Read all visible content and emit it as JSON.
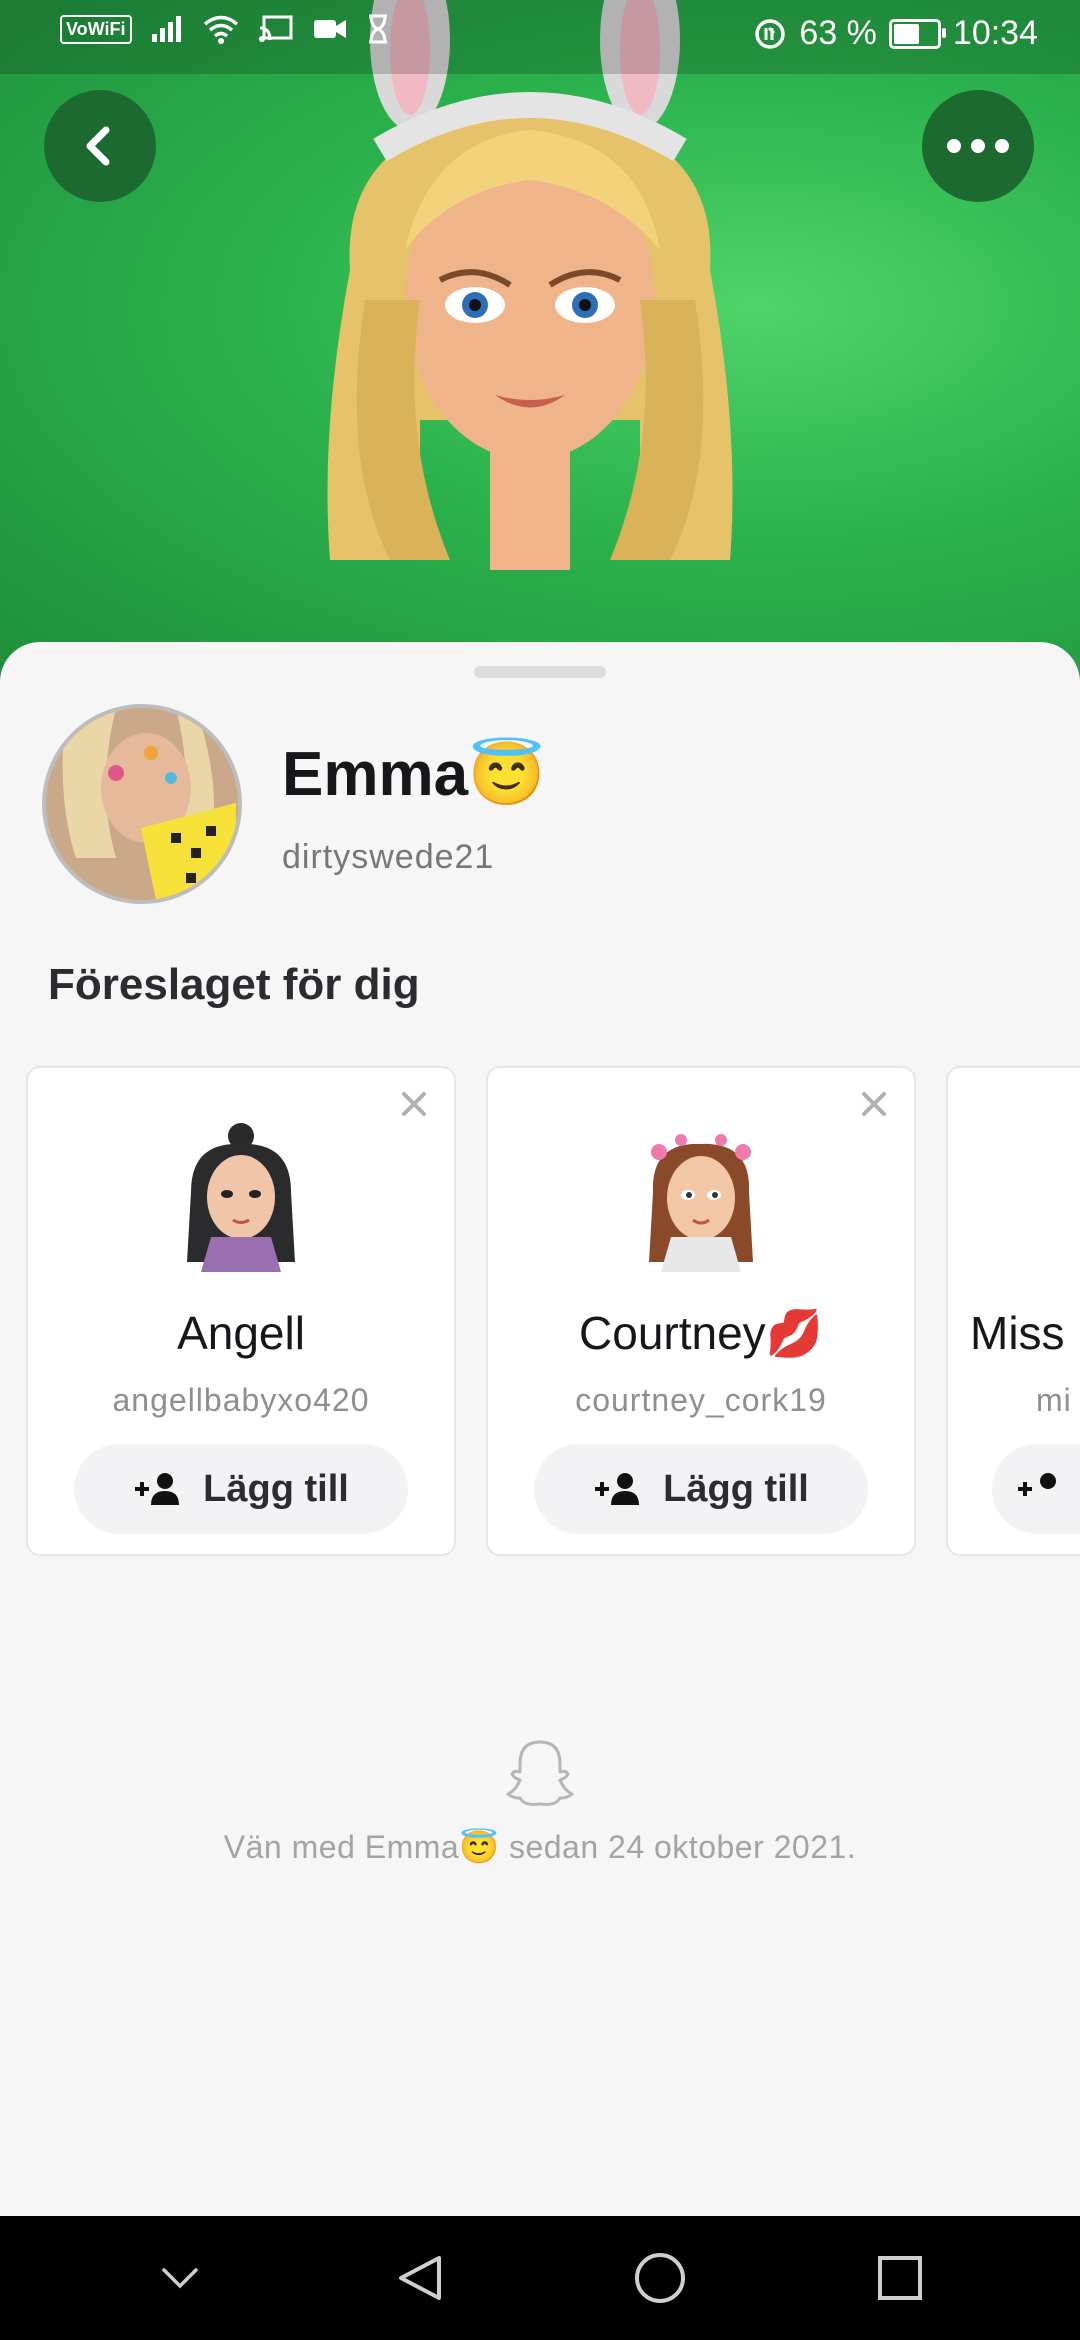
{
  "status_bar": {
    "vowifi": "VoWiFi",
    "battery_percent": "63 %",
    "battery_level": 0.63,
    "time": "10:34",
    "icons": [
      "signal-icon",
      "wifi-icon",
      "cast-icon",
      "video-icon",
      "hourglass-icon",
      "data-saver-icon",
      "battery-icon"
    ]
  },
  "header": {
    "back_icon": "chevron-left-icon",
    "more_icon": "more-horizontal-icon",
    "background_color": "#2bb24c"
  },
  "profile": {
    "display_name": "Emma😇",
    "username": "dirtyswede21"
  },
  "suggestions": {
    "title": "Föreslaget för dig",
    "cards": [
      {
        "name": "Angell",
        "username": "angellbabyxo420",
        "add_label": "Lägg till"
      },
      {
        "name": "Courtney💋",
        "username": "courtney_cork19",
        "add_label": "Lägg till"
      },
      {
        "name": "Miss",
        "username": "mi",
        "add_label": ""
      }
    ]
  },
  "footer": {
    "friends_since": "Vän med Emma😇 sedan 24 oktober 2021."
  },
  "navbar": {
    "icons": [
      "collapse-icon",
      "back-triangle-icon",
      "home-circle-icon",
      "recents-square-icon"
    ]
  }
}
